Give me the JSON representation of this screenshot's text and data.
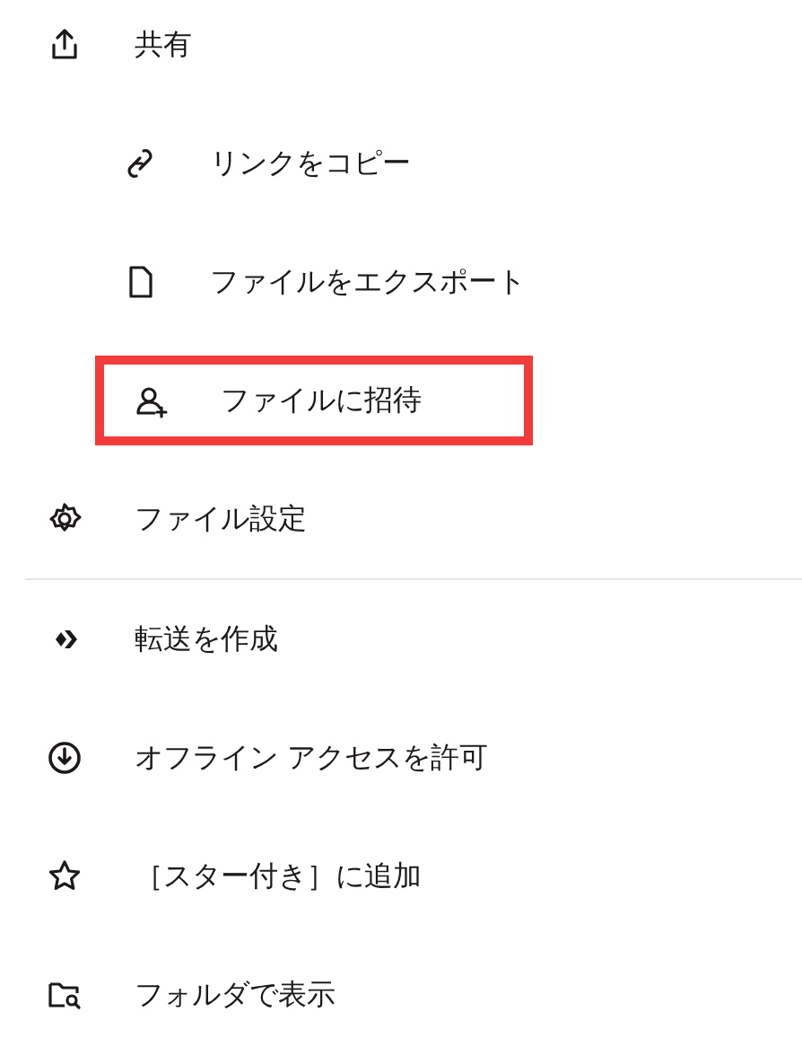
{
  "menu": {
    "groups": [
      {
        "items": [
          {
            "label": "共有",
            "highlighted": false,
            "children": [
              {
                "label": "リンクをコピー",
                "highlighted": false
              },
              {
                "label": "ファイルをエクスポート",
                "highlighted": false
              },
              {
                "label": "ファイルに招待",
                "highlighted": true
              }
            ]
          },
          {
            "label": "ファイル設定",
            "highlighted": false
          }
        ]
      },
      {
        "items": [
          {
            "label": "転送を作成",
            "highlighted": false
          },
          {
            "label": "オフライン アクセスを許可",
            "highlighted": false
          },
          {
            "label": "［スター付き］に追加",
            "highlighted": false
          },
          {
            "label": "フォルダで表示",
            "highlighted": false
          }
        ]
      }
    ]
  }
}
